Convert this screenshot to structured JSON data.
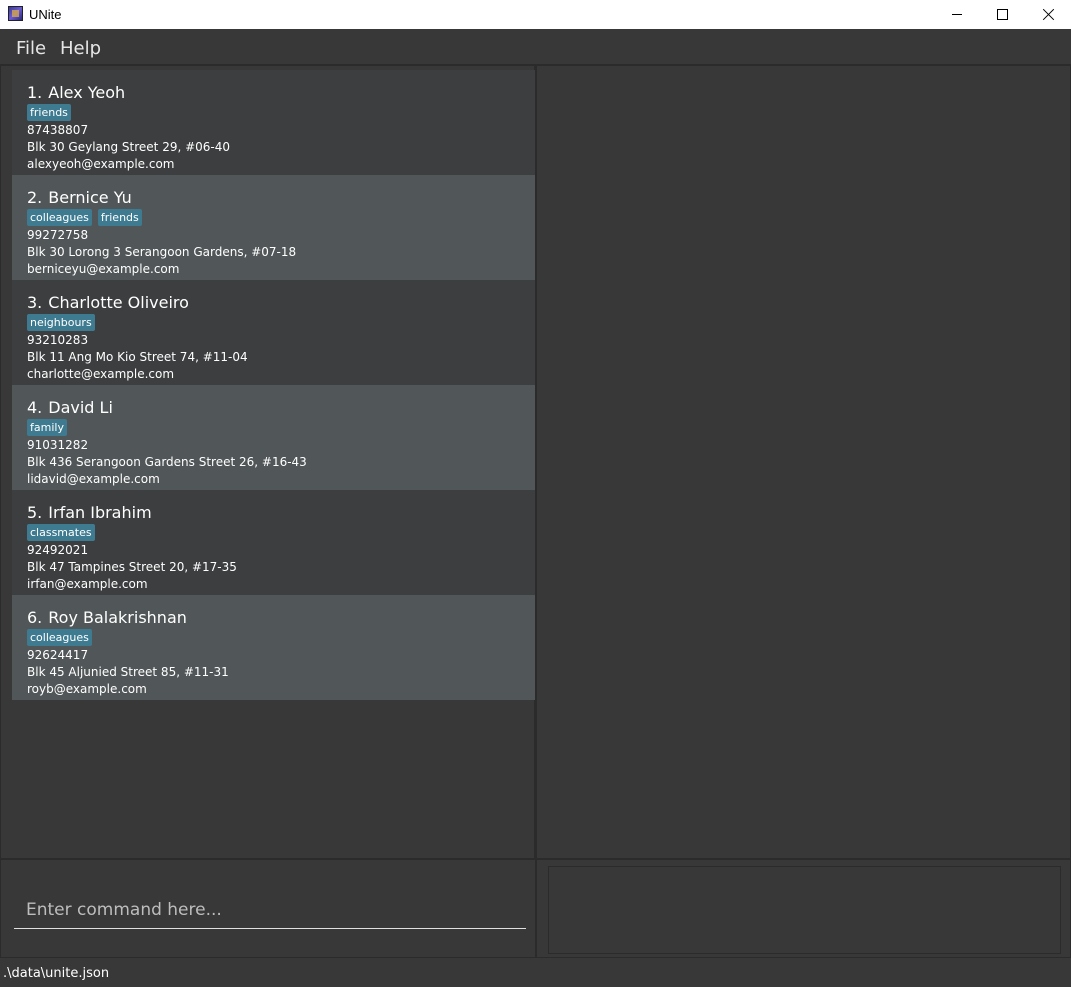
{
  "window": {
    "title": "UNite",
    "icon": "app-icon"
  },
  "menu": {
    "file": "File",
    "help": "Help"
  },
  "persons": [
    {
      "index": "1.",
      "name": "Alex Yeoh",
      "tags": [
        "friends"
      ],
      "phone": "87438807",
      "address": "Blk 30 Geylang Street 29, #06-40",
      "email": "alexyeoh@example.com"
    },
    {
      "index": "2.",
      "name": "Bernice Yu",
      "tags": [
        "colleagues",
        "friends"
      ],
      "phone": "99272758",
      "address": "Blk 30 Lorong 3 Serangoon Gardens, #07-18",
      "email": "berniceyu@example.com"
    },
    {
      "index": "3.",
      "name": "Charlotte Oliveiro",
      "tags": [
        "neighbours"
      ],
      "phone": "93210283",
      "address": "Blk 11 Ang Mo Kio Street 74, #11-04",
      "email": "charlotte@example.com"
    },
    {
      "index": "4.",
      "name": "David Li",
      "tags": [
        "family"
      ],
      "phone": "91031282",
      "address": "Blk 436 Serangoon Gardens Street 26, #16-43",
      "email": "lidavid@example.com"
    },
    {
      "index": "5.",
      "name": "Irfan Ibrahim",
      "tags": [
        "classmates"
      ],
      "phone": "92492021",
      "address": "Blk 47 Tampines Street 20, #17-35",
      "email": "irfan@example.com"
    },
    {
      "index": "6.",
      "name": "Roy Balakrishnan",
      "tags": [
        "colleagues"
      ],
      "phone": "92624417",
      "address": "Blk 45 Aljunied Street 85, #11-31",
      "email": "royb@example.com"
    }
  ],
  "command": {
    "placeholder": "Enter command here...",
    "value": ""
  },
  "result": {
    "text": ""
  },
  "status": {
    "path": ".\\data\\unite.json"
  },
  "colors": {
    "background": "#383838",
    "card_odd": "#3c3e3f",
    "card_even": "#515658",
    "tag": "#3e7b91",
    "text": "#ffffff"
  }
}
